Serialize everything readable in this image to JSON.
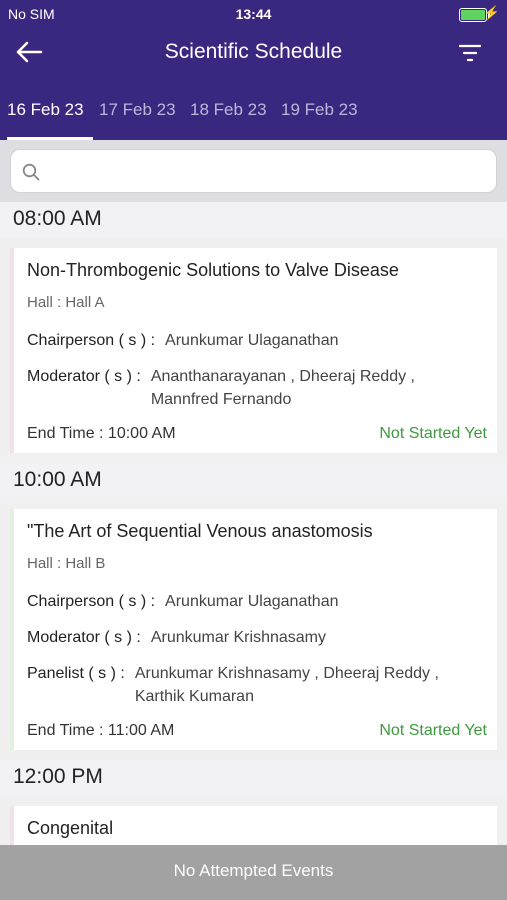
{
  "status_bar": {
    "carrier": "No SIM",
    "time": "13:44"
  },
  "nav": {
    "title": "Scientific Schedule",
    "back_icon": "arrow-left-icon",
    "filter_icon": "filter-icon"
  },
  "tabs": [
    {
      "label": "16 Feb 23",
      "active": true
    },
    {
      "label": "17 Feb 23",
      "active": false
    },
    {
      "label": "18 Feb 23",
      "active": false
    },
    {
      "label": "19 Feb 23",
      "active": false
    }
  ],
  "search": {
    "value": "",
    "placeholder": ""
  },
  "schedule": [
    {
      "time": "08:00 AM",
      "session": {
        "title": "Non-Thrombogenic Solutions to Valve Disease",
        "hall": "Hall : Hall A",
        "chair_label": "Chairperson ( s ) :",
        "chair_value": "Arunkumar Ulaganathan",
        "mod_label": "Moderator ( s ) :",
        "mod_value": "Ananthanarayanan , Dheeraj Reddy , Mannfred Fernando",
        "end_time": "End Time : 10:00 AM",
        "status": "Not Started Yet"
      }
    },
    {
      "time": "10:00 AM",
      "session": {
        "title": "\"The Art of Sequential Venous anastomosis",
        "hall": "Hall : Hall B",
        "chair_label": "Chairperson ( s ) :",
        "chair_value": "Arunkumar Ulaganathan",
        "mod_label": "Moderator ( s ) :",
        "mod_value": "Arunkumar Krishnasamy",
        "panel_label": "Panelist ( s ) :",
        "panel_value": "Arunkumar Krishnasamy , Dheeraj Reddy , Karthik Kumaran",
        "end_time": "End Time : 11:00 AM",
        "status": "Not Started Yet"
      }
    },
    {
      "time": "12:00 PM",
      "session": {
        "title": "Congenital"
      }
    }
  ],
  "bottom_bar": {
    "label": "No Attempted Events"
  },
  "colors": {
    "header": "#3a2880",
    "status_green": "#3e9a3e",
    "bottom_bar": "#a2a2a2"
  }
}
